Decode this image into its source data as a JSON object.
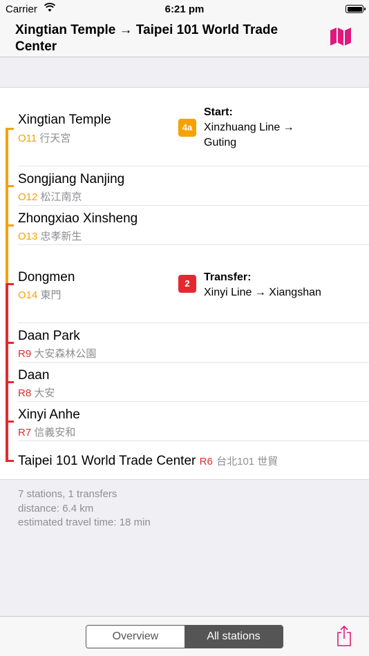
{
  "status_bar": {
    "carrier": "Carrier",
    "time": "6:21 pm"
  },
  "nav": {
    "title": "Xingtian Temple → Taipei 101 World Trade Center",
    "map_icon": "map-icon"
  },
  "colors": {
    "orange_line": "#f5a200",
    "red_line": "#e3292f",
    "accent": "#e0197d"
  },
  "stations": [
    {
      "name": "Xingtian Temple",
      "code": "O11",
      "chinese": "行天宮"
    },
    {
      "name": "Songjiang Nanjing",
      "code": "O12",
      "chinese": "松江南京"
    },
    {
      "name": "Zhongxiao Xinsheng",
      "code": "O13",
      "chinese": "忠孝新生"
    },
    {
      "name": "Dongmen",
      "code": "O14",
      "chinese": "東門"
    },
    {
      "name": "Daan Park",
      "code": "R9",
      "chinese": "大安森林公園"
    },
    {
      "name": "Daan",
      "code": "R8",
      "chinese": "大安"
    },
    {
      "name": "Xinyi Anhe",
      "code": "R7",
      "chinese": "信義安和"
    },
    {
      "name": "Taipei 101 World Trade Center",
      "code": "R6",
      "chinese": "台北101 世貿"
    }
  ],
  "instructions": {
    "start": {
      "badge": "4a",
      "title": "Start:",
      "line1": "Xinzhuang Line →",
      "line2": "Guting"
    },
    "transfer": {
      "badge": "2",
      "title": "Transfer:",
      "line1": "Xinyi Line → Xiangshan"
    }
  },
  "summary": {
    "stations": "7 stations, 1 transfers",
    "distance": "distance: 6.4 km",
    "time": "estimated travel time: 18 min"
  },
  "toolbar": {
    "segments": [
      {
        "label": "Overview",
        "selected": false
      },
      {
        "label": "All stations",
        "selected": true
      }
    ],
    "share_icon": "share-icon"
  }
}
